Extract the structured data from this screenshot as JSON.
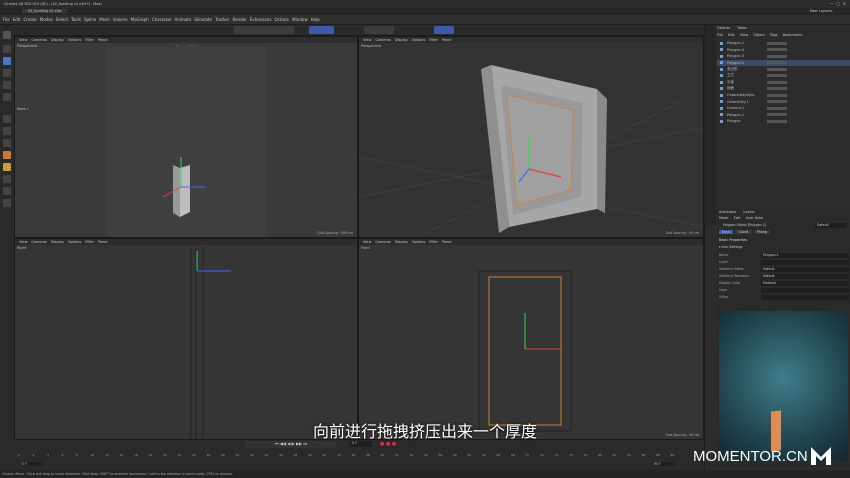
{
  "window": {
    "title": "Cinema 4D R25.015 (RC) - [02_building v2.c4d *] - Main"
  },
  "tab": {
    "name": "02_building v2.c4d"
  },
  "menu": [
    "File",
    "Edit",
    "Create",
    "Modes",
    "Select",
    "Tools",
    "Spline",
    "Mesh",
    "Volume",
    "MoGraph",
    "Character",
    "Animate",
    "Simulate",
    "Tracker",
    "Render",
    "Extensions",
    "Octane",
    "Window",
    "Help"
  ],
  "layouts": {
    "items": [
      "Startup (User)",
      "Standard",
      "Standard (old 3 views)",
      "Model",
      "Sculpt",
      "UV Edit",
      "Paint",
      "Groom",
      "Track",
      "Script",
      "Nodes"
    ],
    "active": 0,
    "new_layouts": "New Layouts"
  },
  "viewport_menu": [
    "View",
    "Cameras",
    "Display",
    "Options",
    "Filter",
    "Panel"
  ],
  "viewports": {
    "tl": {
      "label": "Perspective",
      "camera": "Camera 1 ⚐",
      "grid": "Grid Spacing : 500 cm"
    },
    "tr": {
      "label": "Perspective",
      "grid": "Grid Spacing : 50 cm"
    },
    "bl": {
      "label": "Right"
    },
    "br": {
      "label": "Front",
      "grid": "Grid Spacing : 50 cm"
    }
  },
  "move_label": "Move ⊹",
  "objects_panel": {
    "tabs": [
      "Objects",
      "Takes"
    ],
    "menu": [
      "File",
      "Edit",
      "View",
      "Object",
      "Tags",
      "Bookmarks"
    ],
    "items": [
      "Polygon.1",
      "Polygon.0",
      "Polygon.3",
      "Polygon.2",
      "多边形",
      "立方",
      "平面",
      "地面",
      "OctaneDaylight",
      "OctaneSky.1",
      "Camera.1",
      "Polygon.1",
      "Polygon"
    ]
  },
  "attributes_panel": {
    "tabs": [
      "Attributes",
      "Layers"
    ],
    "menu": [
      "Mode",
      "Edit",
      "User Data"
    ],
    "object_title": "Polygon Object [Polygon.2]",
    "mode_value": "Default",
    "subtabs": [
      "Basic",
      "Coord.",
      "Phong"
    ],
    "section": "Basic Properties",
    "subsection": "▾ Icon Settings",
    "rows": [
      {
        "k": "Name",
        "v": "Polygon.2"
      },
      {
        "k": "Layer",
        "v": ""
      },
      {
        "k": "Visible in Editor",
        "v": "Default"
      },
      {
        "k": "Visible in Renderer",
        "v": "Default"
      },
      {
        "k": "Display Color",
        "v": "Material"
      },
      {
        "k": "Color",
        "v": ""
      },
      {
        "k": "X-Ray",
        "v": ""
      }
    ]
  },
  "timeline": {
    "ticks": [
      "0",
      "2",
      "4",
      "6",
      "8",
      "10",
      "12",
      "14",
      "16",
      "18",
      "20",
      "22",
      "24",
      "26",
      "28",
      "30",
      "32",
      "34",
      "36",
      "38",
      "40",
      "42",
      "44",
      "46",
      "48",
      "50",
      "52",
      "54",
      "56",
      "58",
      "60",
      "62",
      "64",
      "66",
      "68",
      "70",
      "72",
      "74",
      "76",
      "78",
      "80",
      "82",
      "84",
      "86",
      "88",
      "90"
    ],
    "current_frame": "0 F",
    "start": "0 F",
    "end": "90 F",
    "fps_field": "0 F"
  },
  "status": {
    "text": "Octane:   Move : Click and drag to move elements. Hold down SHIFT to quantize movement / add to the selection in point mode, CTRL to remove."
  },
  "subtitle": "向前进行拖拽挤压出来一个厚度",
  "watermark": "MOMENTOR.CN"
}
